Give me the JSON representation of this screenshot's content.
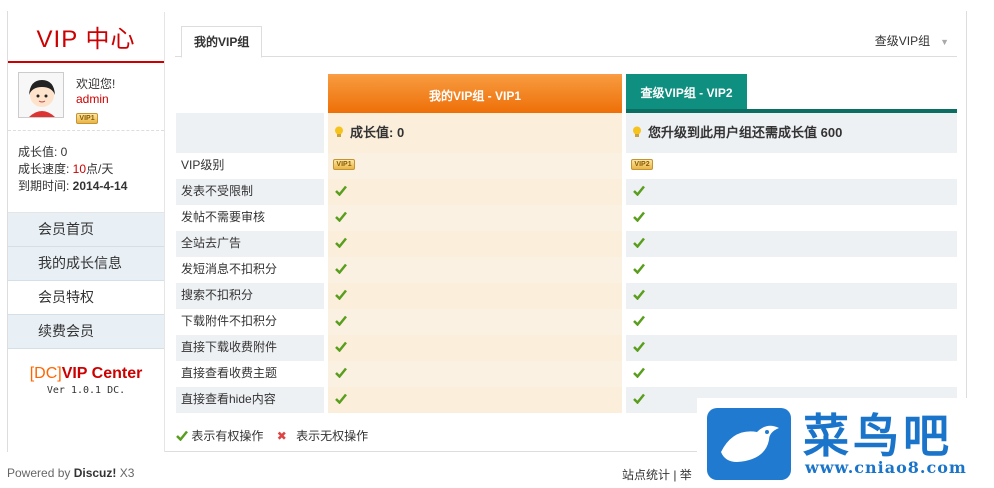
{
  "sidebar": {
    "title": "VIP 中心",
    "welcome": "欢迎您!",
    "username": "admin",
    "user_badge": "VIP1",
    "stats": {
      "growth_label": "成长值: ",
      "growth_value": "0",
      "speed_label": "成长速度: ",
      "speed_value": "10",
      "speed_unit": "点/天",
      "expire_label": "到期时间: ",
      "expire_value": "2014-4-14"
    },
    "nav": [
      {
        "label": "会员首页"
      },
      {
        "label": "我的成长信息"
      },
      {
        "label": "会员特权",
        "active": true
      },
      {
        "label": "续费会员"
      }
    ],
    "brand_dc": "[DC]",
    "brand_name": "VIP Center",
    "brand_version": "Ver 1.0.1 DC."
  },
  "tabs": {
    "active": "我的VIP组",
    "right_select": "查级VIP组"
  },
  "compare": {
    "col1_header": "我的VIP组 - VIP1",
    "col2_header": "查级VIP组 - VIP2",
    "col1_info": "成长值: 0",
    "col2_info": "您升级到此用户组还需成长值 600",
    "vip_level_label": "VIP级别",
    "col1_badge": "VIP1",
    "col2_badge": "VIP2",
    "features": [
      "发表不受限制",
      "发帖不需要审核",
      "全站去广告",
      "发短消息不扣积分",
      "搜索不扣积分",
      "下载附件不扣积分",
      "直接下载收费附件",
      "直接查看收费主题",
      "直接查看hide内容"
    ]
  },
  "legend": {
    "allowed": "表示有权操作",
    "denied": "表示无权操作"
  },
  "footer": {
    "powered_prefix": "Powered by ",
    "powered_brand": "Discuz!",
    "powered_version": " X3",
    "links": "站点统计 | 举"
  },
  "watermark": {
    "title": "菜鸟吧",
    "url": "www.cniao8.com"
  },
  "colors": {
    "brand_red": "#cc0000",
    "vip1_orange": "#f37d14",
    "vip2_teal": "#0e8f7f",
    "check_green": "#5a9e1e",
    "watermark_blue": "#1a74c9"
  }
}
